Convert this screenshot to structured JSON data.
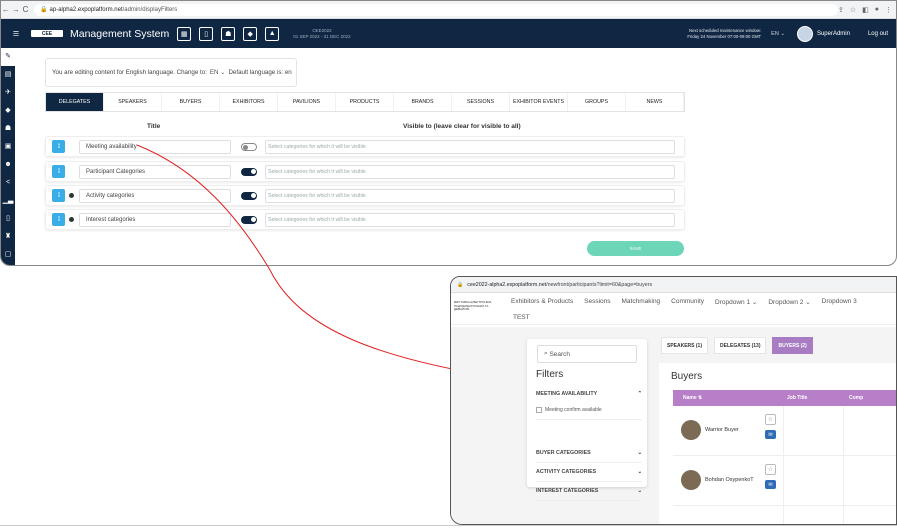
{
  "top": {
    "url_host": "ap-alpha2.expoplatform.net",
    "url_path": "/admin/displayFilters",
    "logo_text": "CEE",
    "app_title": "Management System",
    "event_name": "CEE2022",
    "event_dates": "01 SEP 2022 - 31 DEC 2022",
    "maint_line1": "Next scheduled maintenance window:",
    "maint_line2": "Friday 24 November 07:00-09:00 GMT",
    "lang_sel": "EN ⌄",
    "admin_name": "SuperAdmin",
    "logout": "Log out",
    "lang_prefix": "You are editing content for English language. Change to:",
    "lang_value": "EN",
    "lang_suffix": "Default language is: en",
    "tabs": [
      "DELEGATES",
      "SPEAKERS",
      "BUYERS",
      "EXHIBITORS",
      "PAVILIONS",
      "PRODUCTS",
      "BRANDS",
      "SESSIONS",
      "EXHIBITOR EVENTS",
      "GROUPS",
      "NEWS"
    ],
    "col_title": "Title",
    "col_visible": "Visible to (leave clear for visible to all)",
    "rows": [
      {
        "title": "Meeting availability",
        "on": false,
        "info": false
      },
      {
        "title": "Participant Categories",
        "on": true,
        "info": false
      },
      {
        "title": "Activity categories",
        "on": true,
        "info": true
      },
      {
        "title": "Interest categories",
        "on": true,
        "info": true
      }
    ],
    "cat_placeholder": "Select categories for which it will be visible",
    "save": "SAVE"
  },
  "bottom": {
    "url_host": "cee2022-alpha2.expoplatform.net",
    "url_path": "/newfront/participants?limit=60&page=buyers",
    "logo_text": "ВИСТАВКА ЕЛЕКТРОНІКИ, РАДІОЕЛЕКТРОНІКИ ТА ДЕВАЙСІВ",
    "menu": [
      "Exhibitors & Products",
      "Sessions",
      "Matchmaking",
      "Community",
      "Dropdown 1 ⌄",
      "Dropdown 2 ⌄",
      "Dropdown 3"
    ],
    "test": "TEST",
    "search": "Search",
    "filters_title": "Filters",
    "filter_groups": [
      "MEETING AVAILABILITY",
      "BUYER CATEGORIES",
      "ACTIVITY CATEGORIES",
      "INTEREST CATEGORIES"
    ],
    "checkbox_label": "Meeting confirm available",
    "tabs": [
      "SPEAKERS (1)",
      "DELEGATES (13)",
      "BUYERS (2)"
    ],
    "buyers_title": "Buyers",
    "th_name": "Name",
    "th_job": "Job Title",
    "th_comp": "Comp",
    "buyers": [
      {
        "name": "Warrior Buyer"
      },
      {
        "name": "Bohdan OsypenkoT"
      }
    ]
  },
  "colors": {
    "navy": "#0f2742",
    "accent": "#39aee6",
    "save": "#6dd5b8",
    "purple": "#b67fc8",
    "arrow": "#e02020"
  }
}
